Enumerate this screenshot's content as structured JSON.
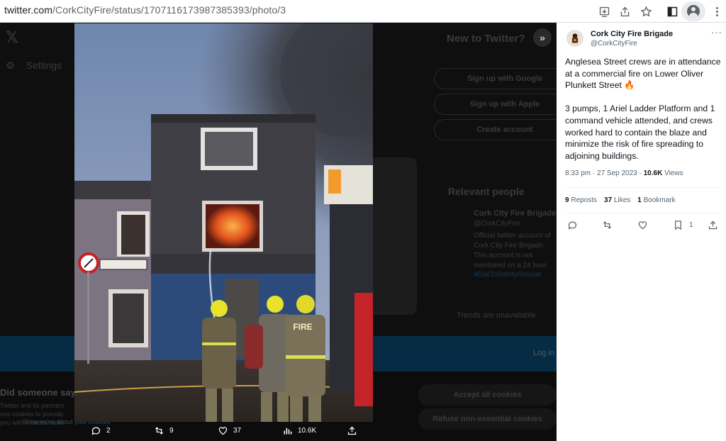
{
  "browser": {
    "url_host": "twitter.com",
    "url_path": "/CorkCityFire/status/1707116173987385393/photo/3"
  },
  "background": {
    "settings": "Settings",
    "new_to_twitter": "New to Twitter?",
    "signup_google": "Sign up with Google",
    "signup_apple": "Sign up with Apple",
    "create_account": "Create account",
    "relevant_people": "Relevant people",
    "rp_name": "Cork City Fire Brigade",
    "rp_handle": "@CorkCityFire",
    "rp_bio": "Official twitter account of Cork City Fire Brigade. This account is not monitored on a 24 hour basis. In the event of an emergency dial",
    "rp_hashtag": "#DialToSafetyRescue",
    "trends": "Trends are unavailable.",
    "login": "Log in",
    "cookie_title": "Did someone say … cookies?",
    "cookie_body": "Twitter and its partners use cookies to provide you with a better, safer and faster service and to support our business. Some cookies are necessary to use our services, improve our services, and make sure they work properly.",
    "cookie_link": "Show more about your choices",
    "accept_cookies": "Accept all cookies",
    "refuse_cookies": "Refuse non-essential cookies"
  },
  "photo_actions": {
    "replies": "2",
    "reposts": "9",
    "likes": "37",
    "views": "10.6K"
  },
  "tweet": {
    "name": "Cork City Fire Brigade",
    "handle": "@CorkCityFire",
    "paragraph1": "Anglesea Street crews are in attendance at a commercial fire on Lower Oliver Plunkett Street 🔥",
    "paragraph2": "3 pumps, 1 Ariel Ladder Platform and 1 command vehicle attended, and crews worked hard to contain the blaze and minimize the risk of fire spreading to adjoining buildings.",
    "time": "8:33 pm · 27 Sep 2023 · ",
    "views_count": "10.6K",
    "views_label": " Views",
    "reposts_count": "9",
    "reposts_label": "Reposts",
    "likes_count": "37",
    "likes_label": "Likes",
    "bookmarks_count": "1",
    "bookmarks_label": "Bookmark",
    "bookmark_action_count": "1"
  },
  "colors": {
    "viewer_bg": "#0f0f0f",
    "accent_blue": "#1d9bf0",
    "text_primary": "#0f1419",
    "text_secondary": "#536471"
  }
}
